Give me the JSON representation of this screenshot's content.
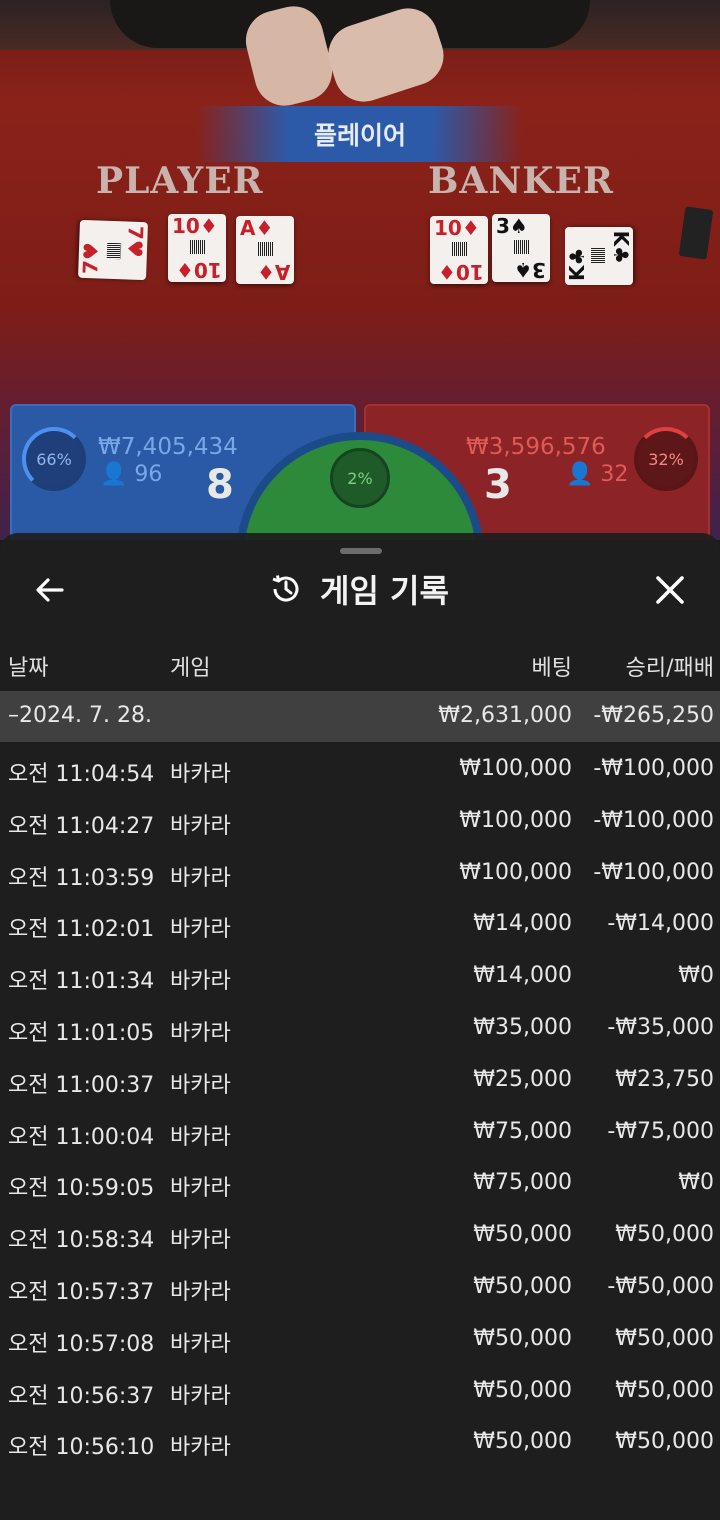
{
  "scene": {
    "result_banner": "플레이어",
    "player_title": "PLAYER",
    "banker_title": "BANKER",
    "player_cards": [
      {
        "rank": "7",
        "suit": "♥",
        "color": "red"
      },
      {
        "rank": "10",
        "suit": "♦",
        "color": "red"
      },
      {
        "rank": "A",
        "suit": "♦",
        "color": "red"
      }
    ],
    "banker_cards": [
      {
        "rank": "10",
        "suit": "♦",
        "color": "red"
      },
      {
        "rank": "3",
        "suit": "♠",
        "color": "blk"
      },
      {
        "rank": "K",
        "suit": "♣",
        "color": "blk"
      }
    ],
    "player_panel": {
      "percent": "66%",
      "amount": "₩7,405,434",
      "count": "96",
      "score": "8"
    },
    "banker_panel": {
      "percent": "32%",
      "amount": "₩3,596,576",
      "count": "32",
      "score": "3"
    },
    "tie_panel": {
      "percent": "2%"
    }
  },
  "sheet": {
    "title": "게임 기록",
    "history_icon": "history-icon",
    "back_icon": "arrow-left-icon",
    "close_icon": "close-icon",
    "columns": {
      "date": "날짜",
      "game": "게임",
      "bet": "베팅",
      "result": "승리/패배"
    },
    "summary": {
      "date": "–2024. 7. 28.",
      "bet": "₩2,631,000",
      "result": "-₩265,250"
    },
    "rows": [
      {
        "time": "오전 11:04:54",
        "game": "바카라",
        "bet": "₩100,000",
        "result": "-₩100,000"
      },
      {
        "time": "오전 11:04:27",
        "game": "바카라",
        "bet": "₩100,000",
        "result": "-₩100,000"
      },
      {
        "time": "오전 11:03:59",
        "game": "바카라",
        "bet": "₩100,000",
        "result": "-₩100,000"
      },
      {
        "time": "오전 11:02:01",
        "game": "바카라",
        "bet": "₩14,000",
        "result": "-₩14,000"
      },
      {
        "time": "오전 11:01:34",
        "game": "바카라",
        "bet": "₩14,000",
        "result": "₩0"
      },
      {
        "time": "오전 11:01:05",
        "game": "바카라",
        "bet": "₩35,000",
        "result": "-₩35,000"
      },
      {
        "time": "오전 11:00:37",
        "game": "바카라",
        "bet": "₩25,000",
        "result": "₩23,750"
      },
      {
        "time": "오전 11:00:04",
        "game": "바카라",
        "bet": "₩75,000",
        "result": "-₩75,000"
      },
      {
        "time": "오전 10:59:05",
        "game": "바카라",
        "bet": "₩75,000",
        "result": "₩0"
      },
      {
        "time": "오전 10:58:34",
        "game": "바카라",
        "bet": "₩50,000",
        "result": "₩50,000"
      },
      {
        "time": "오전 10:57:37",
        "game": "바카라",
        "bet": "₩50,000",
        "result": "-₩50,000"
      },
      {
        "time": "오전 10:57:08",
        "game": "바카라",
        "bet": "₩50,000",
        "result": "₩50,000"
      },
      {
        "time": "오전 10:56:37",
        "game": "바카라",
        "bet": "₩50,000",
        "result": "₩50,000"
      },
      {
        "time": "오전 10:56:10",
        "game": "바카라",
        "bet": "₩50,000",
        "result": "₩50,000"
      }
    ]
  }
}
